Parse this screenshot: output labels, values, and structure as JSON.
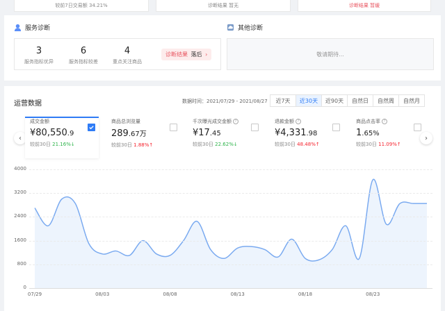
{
  "top_strip": {
    "left_text": "较前7日交易额 34.21%",
    "mid_text": "诊断结果 暂无",
    "right_text": "诊断结果 暂缓"
  },
  "service_diag": {
    "title": "服务诊断",
    "stats": [
      {
        "value": "3",
        "label": "服务指标优异"
      },
      {
        "value": "6",
        "label": "服务指标较差"
      },
      {
        "value": "4",
        "label": "重点关注商品"
      }
    ],
    "result_label": "诊断结果",
    "result_value": "落后",
    "result_arrow": "›"
  },
  "other_diag": {
    "title": "其他诊断",
    "placeholder": "敬请期待..."
  },
  "ops": {
    "title": "运营数据",
    "data_time_label": "数据时间：2021/07/29 - 2021/08/27",
    "tabs": [
      "近7天",
      "近30天",
      "近90天",
      "自然日",
      "自然周",
      "自然月"
    ],
    "active_tab": 1,
    "metrics": [
      {
        "name": "成交金额",
        "value_main": "¥80,550",
        "value_small": ".9",
        "cmp_label": "较前30日",
        "cmp_value": "21.16%",
        "cmp_arrow": "↓",
        "direction": "down",
        "checked": true
      },
      {
        "name": "商品总浏览量",
        "value_main": "289",
        "value_small": ".67万",
        "cmp_label": "较前30日",
        "cmp_value": "1.88%",
        "cmp_arrow": "↑",
        "direction": "up",
        "checked": false
      },
      {
        "name": "千次曝光成交金额",
        "value_main": "¥17",
        "value_small": ".45",
        "cmp_label": "较前30日",
        "cmp_value": "22.62%",
        "cmp_arrow": "↓",
        "direction": "down",
        "checked": false
      },
      {
        "name": "退款金额",
        "value_main": "¥4,331",
        "value_small": ".98",
        "cmp_label": "较前30日",
        "cmp_value": "48.48%",
        "cmp_arrow": "↑",
        "direction": "up",
        "checked": false
      },
      {
        "name": "商品点击率",
        "value_main": "1",
        "value_small": ".65%",
        "cmp_label": "较前30日",
        "cmp_value": "11.09%",
        "cmp_arrow": "↑",
        "direction": "up",
        "checked": false
      }
    ],
    "prev_arrow": "‹",
    "next_arrow": "›"
  },
  "colors": {
    "accent": "#2f7cf6",
    "line": "#7aaaf0",
    "area": "#e6effc",
    "down": "#2db34a",
    "up": "#f5222d",
    "danger_pill_bg": "#fdecec",
    "danger_pill_text": "#e8545f"
  },
  "chart_data": {
    "type": "area",
    "x": [
      "07/29",
      "07/30",
      "07/31",
      "08/01",
      "08/02",
      "08/03",
      "08/04",
      "08/05",
      "08/06",
      "08/07",
      "08/08",
      "08/09",
      "08/10",
      "08/11",
      "08/12",
      "08/13",
      "08/14",
      "08/15",
      "08/16",
      "08/17",
      "08/18",
      "08/19",
      "08/20",
      "08/21",
      "08/22",
      "08/23",
      "08/24",
      "08/25",
      "08/26",
      "08/27"
    ],
    "xticks": [
      "07/29",
      "08/03",
      "08/08",
      "08/13",
      "08/18",
      "08/23"
    ],
    "y": [
      2700,
      2100,
      3000,
      2850,
      1500,
      1150,
      1250,
      1100,
      1600,
      1150,
      1100,
      1600,
      2250,
      1300,
      1000,
      1350,
      1400,
      1300,
      1050,
      1650,
      1000,
      950,
      1300,
      2100,
      1000,
      3650,
      2150,
      2850,
      2850,
      2850
    ],
    "ylim": [
      0,
      4000
    ],
    "yticks": [
      0,
      800,
      1600,
      2400,
      3200,
      4000
    ],
    "grid": true
  }
}
